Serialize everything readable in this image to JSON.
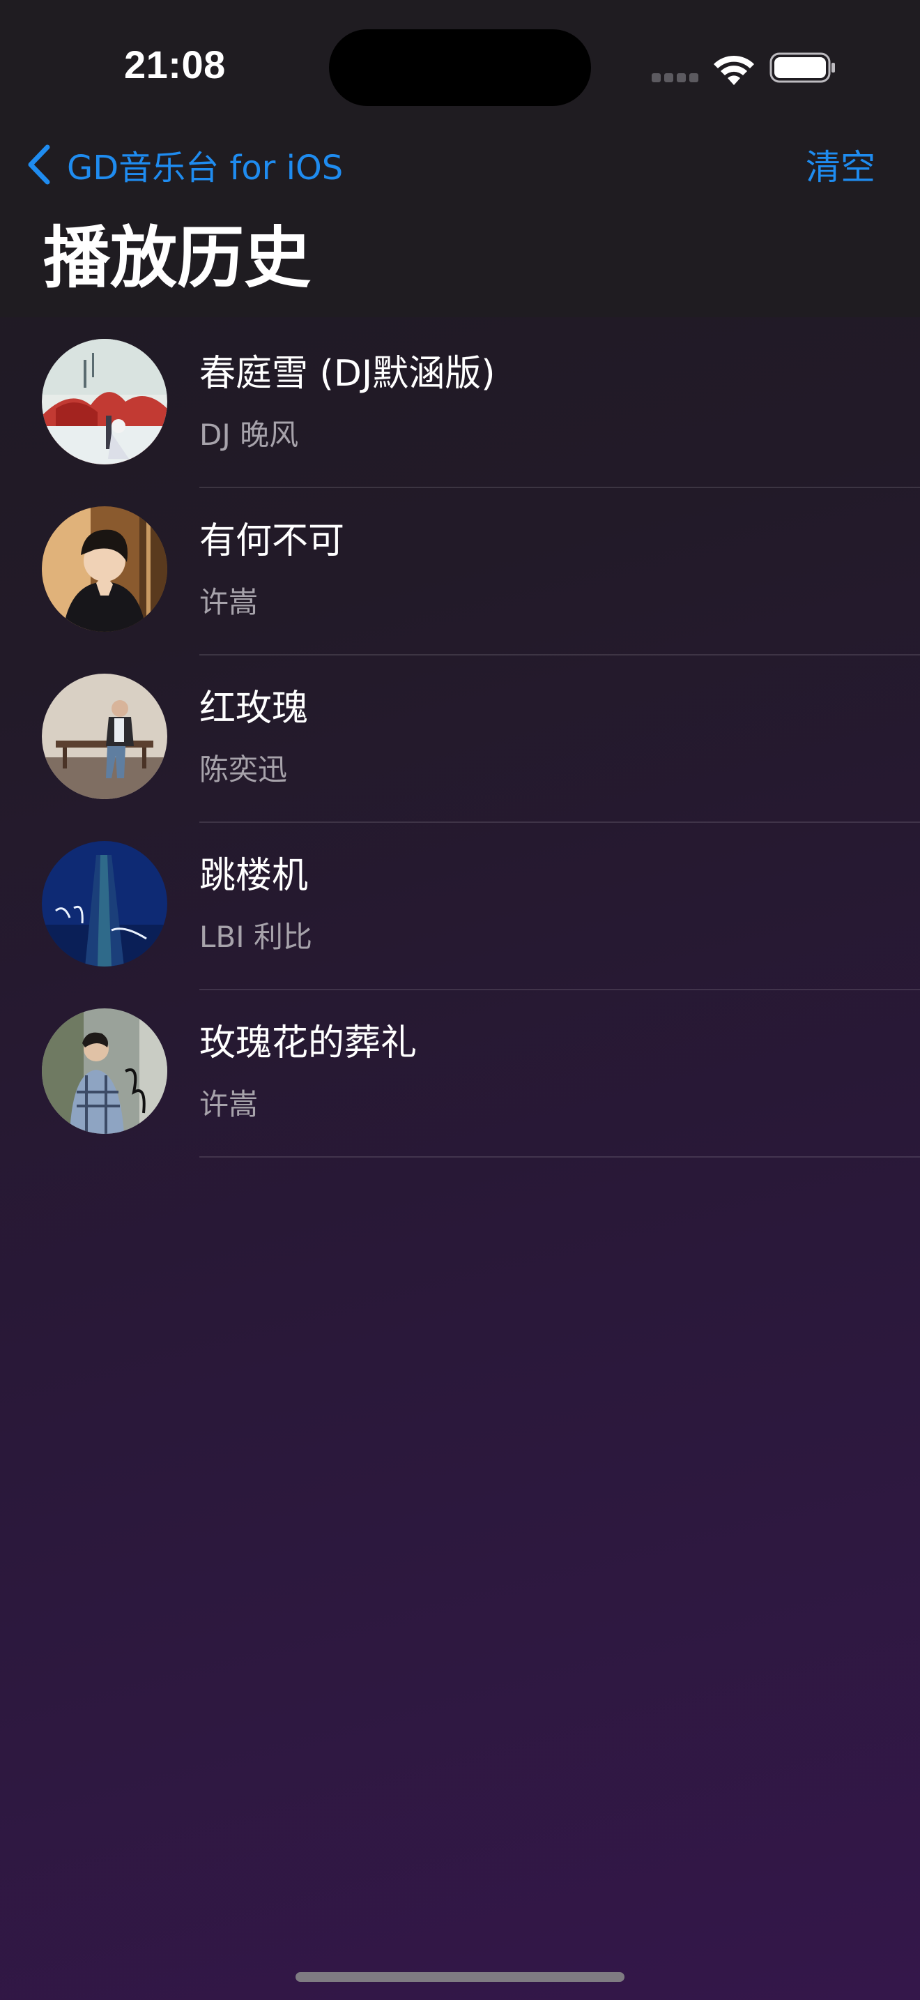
{
  "status_bar": {
    "time": "21:08"
  },
  "nav": {
    "back_label": "GD音乐台 for iOS",
    "clear_label": "清空",
    "title": "播放历史"
  },
  "colors": {
    "accent": "#1f8cf0",
    "secondary_text": "#a7a3ab",
    "background_top": "#1f1c21",
    "background_bottom": "#34174a"
  },
  "history": [
    {
      "title": "春庭雪 (DJ默涵版)",
      "artist": "DJ 晚风",
      "cover_icon": "album-cover-red-tree-snow"
    },
    {
      "title": "有何不可",
      "artist": "许嵩",
      "cover_icon": "album-cover-portrait-warm"
    },
    {
      "title": "红玫瑰",
      "artist": "陈奕迅",
      "cover_icon": "album-cover-man-on-bench"
    },
    {
      "title": "跳楼机",
      "artist": "LBI 利比",
      "cover_icon": "album-cover-blue-tower"
    },
    {
      "title": "玫瑰花的葬礼",
      "artist": "许嵩",
      "cover_icon": "album-cover-portrait-signature"
    }
  ]
}
